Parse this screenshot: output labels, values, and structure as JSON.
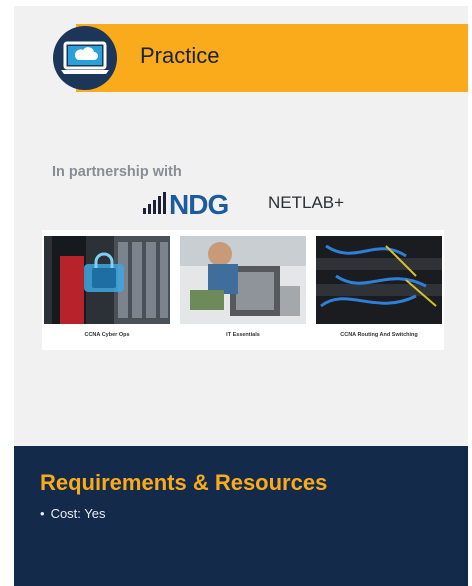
{
  "header": {
    "title": "Practice",
    "icon": "laptop-cloud-icon",
    "banner_color": "#f9ab1c",
    "badge_color": "#1b3659"
  },
  "partnership": {
    "label": "In partnership with",
    "logos": [
      {
        "name": "NDG",
        "icon": "signal-bars-icon",
        "color": "#1d5a9e"
      },
      {
        "name": "NETLAB+"
      }
    ]
  },
  "courses": [
    {
      "label": "CCNA Cyber Ops"
    },
    {
      "label": "IT Essentials"
    },
    {
      "label": "CCNA Routing And Switching"
    }
  ],
  "requirements": {
    "title": "Requirements & Resources",
    "title_color": "#f9ab1c",
    "background": "#132a4a",
    "items": [
      "Cost: Yes"
    ]
  }
}
